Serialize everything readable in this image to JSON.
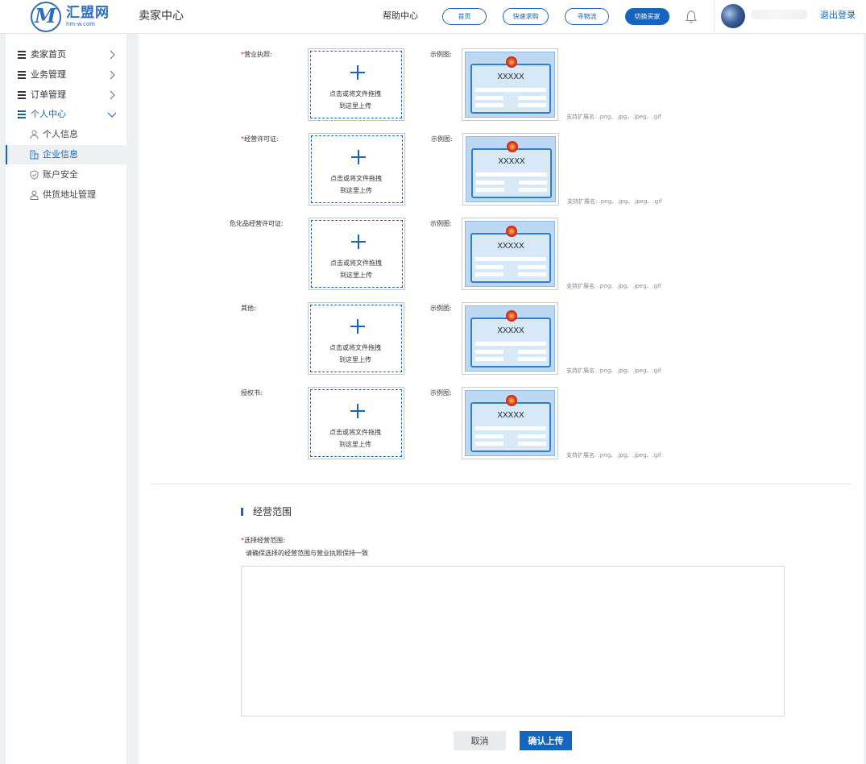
{
  "header": {
    "logo_name": "汇盟网",
    "logo_url": "hm-w.com",
    "title": "卖家中心",
    "help": "帮助中心",
    "nav": [
      {
        "label": "首页"
      },
      {
        "label": "快速求购"
      },
      {
        "label": "寻物流"
      },
      {
        "label": "切换买家"
      }
    ],
    "logout": "退出登录"
  },
  "sidebar": {
    "items": [
      {
        "label": "卖家首页"
      },
      {
        "label": "业务管理"
      },
      {
        "label": "订单管理"
      },
      {
        "label": "个人中心"
      }
    ],
    "sub_items": [
      {
        "label": "个人信息"
      },
      {
        "label": "企业信息"
      },
      {
        "label": "账户安全"
      },
      {
        "label": "供货地址管理"
      }
    ],
    "active_sub": "企业信息"
  },
  "form": {
    "rows": [
      {
        "label": "营业执照:",
        "required": true
      },
      {
        "label": "经营许可证:",
        "required": true
      },
      {
        "label": "危化品经营许可证:",
        "required": false
      },
      {
        "label": "其他:",
        "required": false
      },
      {
        "label": "授权书:",
        "required": false
      }
    ],
    "upload_line1": "点击或将文件拖拽",
    "upload_line2": "到这里上传",
    "sample_label": "示例图:",
    "sample_code": "XXXXX",
    "ext_note": "支持扩展名: .png、.jpg、.jpeg、.gif"
  },
  "scope": {
    "title": "经营范围",
    "label": "选择经营范围:",
    "hint": "请确保选择的经营范围与营业执照保持一致"
  },
  "buttons": {
    "cancel": "取消",
    "submit": "确认上传"
  },
  "colors": {
    "primary": "#1565c0",
    "required": "#e02020",
    "page_bg": "#eef1f4"
  }
}
